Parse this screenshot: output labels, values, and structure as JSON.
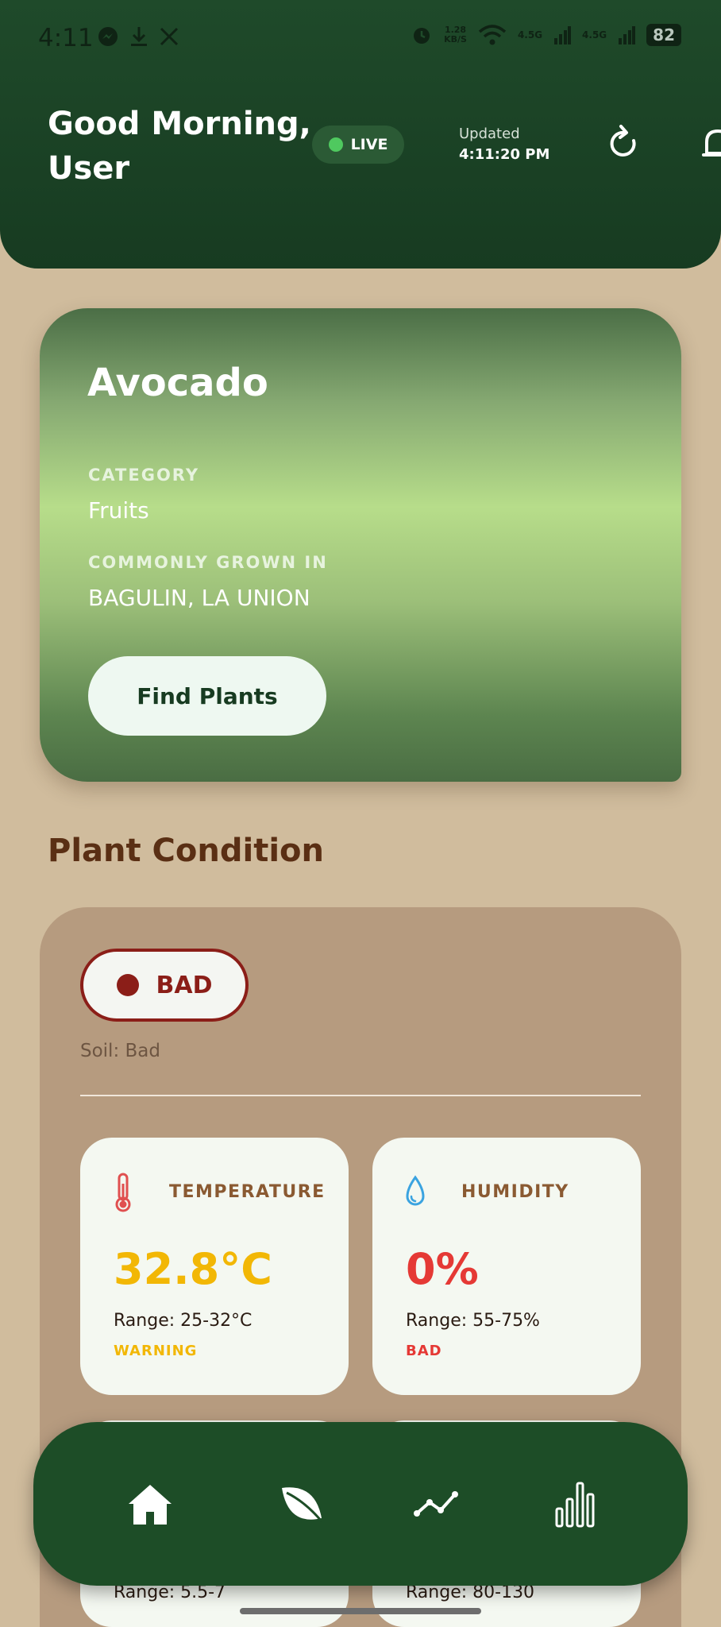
{
  "status_bar": {
    "time": "4:11",
    "net_speed_value": "1.28",
    "net_speed_unit": "KB/S",
    "signal_1": "4.5G",
    "signal_2": "4.5G",
    "battery": "82"
  },
  "header": {
    "greeting": "Good Morning, User",
    "live_label": "LIVE",
    "updated_label": "Updated",
    "updated_time": "4:11:20 PM"
  },
  "plant": {
    "name": "Avocado",
    "category_label": "CATEGORY",
    "category_value": "Fruits",
    "grown_label": "COMMONLY GROWN IN",
    "grown_value": "BAGULIN, LA UNION",
    "find_button": "Find Plants"
  },
  "condition": {
    "section_title": "Plant Condition",
    "overall_status": "BAD",
    "soil_text": "Soil: Bad",
    "metrics": [
      {
        "title": "TEMPERATURE",
        "icon": "thermometer-icon",
        "value": "32.8°C",
        "range": "Range: 25-32°C",
        "status": "WARNING",
        "color": "#f2b705"
      },
      {
        "title": "HUMIDITY",
        "icon": "water-drop-icon",
        "value": "0%",
        "range": "Range: 55-75%",
        "status": "BAD",
        "color": "#e53935"
      }
    ],
    "lower_ranges": [
      "Range: 5.5-7",
      "Range: 80-130"
    ]
  },
  "nav": {
    "items": [
      "home-icon",
      "leaf-icon",
      "trend-line-icon",
      "bar-chart-icon"
    ]
  },
  "colors": {
    "header_bg": "#1f4a2a",
    "page_bg": "#d0bc9d",
    "panel_bg": "#b69b7f",
    "bad": "#8b1e18",
    "warning": "#f2b705",
    "nav_bg": "#1d4d27"
  }
}
